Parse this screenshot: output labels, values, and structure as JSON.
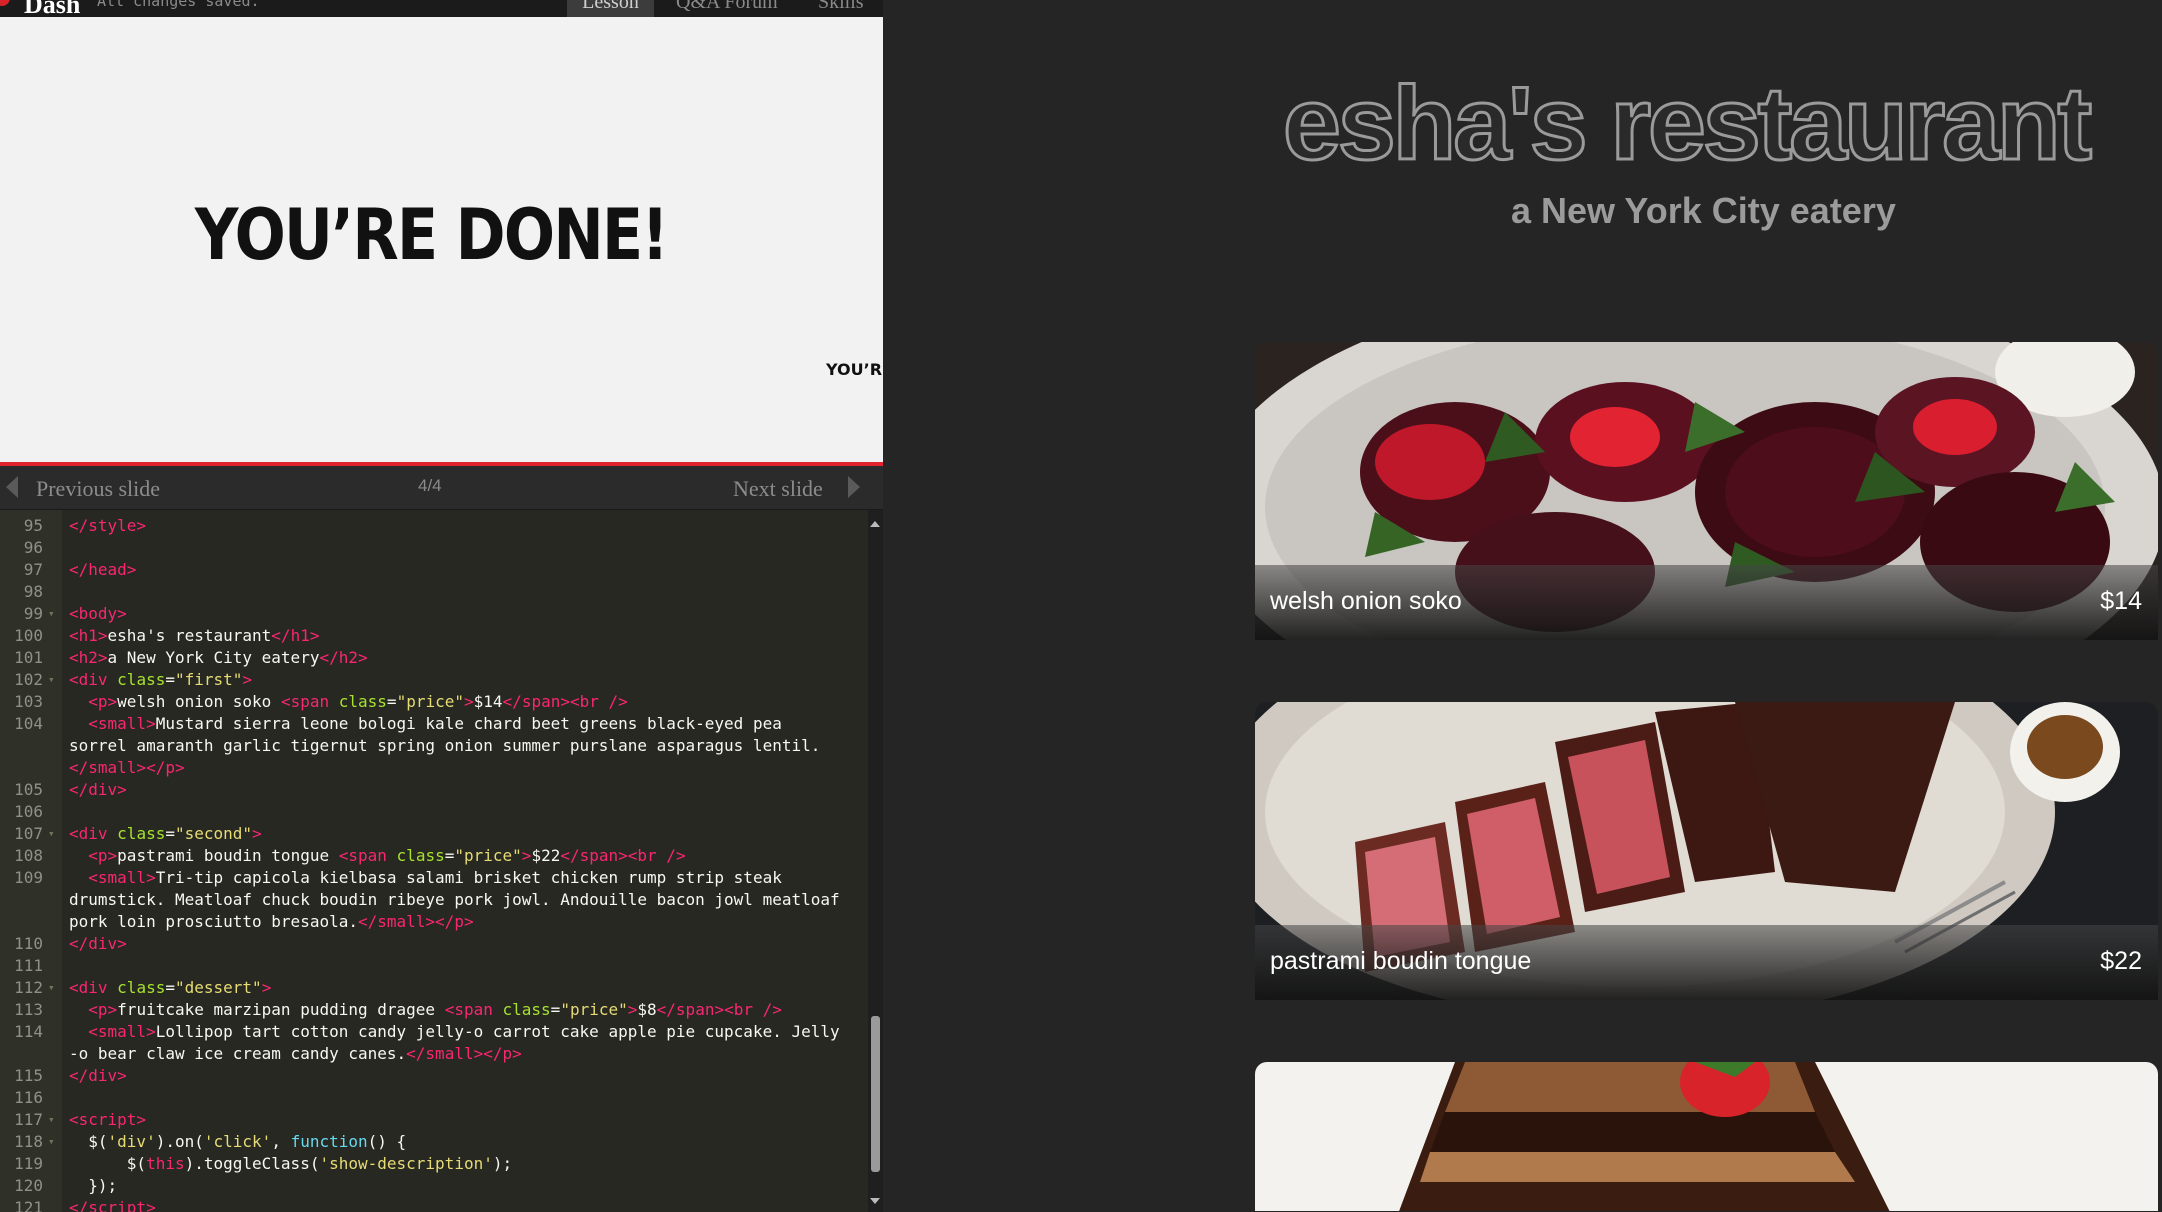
{
  "topbar": {
    "brand": "Dash",
    "save_status": "All changes saved.",
    "tabs": [
      "Lesson",
      "Q&A Forum",
      "Skills"
    ]
  },
  "slide": {
    "title": "YOU’RE DONE!",
    "peek_text": "YOU’RE",
    "accent_color": "#e0232c"
  },
  "slide_nav": {
    "previous_label": "Previous slide",
    "counter": "4/4",
    "next_label": "Next slide"
  },
  "editor": {
    "lines": [
      {
        "n": "95",
        "fold": "",
        "html": "<span class=\"t\">&lt;/style&gt;</span>"
      },
      {
        "n": "96",
        "fold": "",
        "html": ""
      },
      {
        "n": "97",
        "fold": "",
        "html": "<span class=\"t\">&lt;/head&gt;</span>"
      },
      {
        "n": "98",
        "fold": "",
        "html": ""
      },
      {
        "n": "99",
        "fold": "▾",
        "html": "<span class=\"t\">&lt;body&gt;</span>"
      },
      {
        "n": "100",
        "fold": "",
        "html": "<span class=\"t\">&lt;h1&gt;</span>esha's restaurant<span class=\"t\">&lt;/h1&gt;</span>"
      },
      {
        "n": "101",
        "fold": "",
        "html": "<span class=\"t\">&lt;h2&gt;</span>a New York City eatery<span class=\"t\">&lt;/h2&gt;</span>"
      },
      {
        "n": "102",
        "fold": "▾",
        "html": "<span class=\"t\">&lt;div</span> <span class=\"a\">class</span>=<span class=\"s\">\"first\"</span><span class=\"t\">&gt;</span>"
      },
      {
        "n": "103",
        "fold": "",
        "html": "  <span class=\"t\">&lt;p&gt;</span>welsh onion soko <span class=\"t\">&lt;span</span> <span class=\"a\">class</span>=<span class=\"s\">\"price\"</span><span class=\"t\">&gt;</span>$14<span class=\"t\">&lt;/span&gt;&lt;br /&gt;</span>"
      },
      {
        "n": "104",
        "fold": "",
        "html": "  <span class=\"t\">&lt;small&gt;</span>Mustard sierra leone bologi kale chard beet greens black-eyed pea"
      },
      {
        "n": "",
        "fold": "",
        "html": "sorrel amaranth garlic tigernut spring onion summer purslane asparagus lentil."
      },
      {
        "n": "",
        "fold": "",
        "html": "<span class=\"t\">&lt;/small&gt;&lt;/p&gt;</span>"
      },
      {
        "n": "105",
        "fold": "",
        "html": "<span class=\"t\">&lt;/div&gt;</span>"
      },
      {
        "n": "106",
        "fold": "",
        "html": ""
      },
      {
        "n": "107",
        "fold": "▾",
        "html": "<span class=\"t\">&lt;div</span> <span class=\"a\">class</span>=<span class=\"s\">\"second\"</span><span class=\"t\">&gt;</span>"
      },
      {
        "n": "108",
        "fold": "",
        "html": "  <span class=\"t\">&lt;p&gt;</span>pastrami boudin tongue <span class=\"t\">&lt;span</span> <span class=\"a\">class</span>=<span class=\"s\">\"price\"</span><span class=\"t\">&gt;</span>$22<span class=\"t\">&lt;/span&gt;&lt;br /&gt;</span>"
      },
      {
        "n": "109",
        "fold": "",
        "html": "  <span class=\"t\">&lt;small&gt;</span>Tri-tip capicola kielbasa salami brisket chicken rump strip steak"
      },
      {
        "n": "",
        "fold": "",
        "html": "drumstick. Meatloaf chuck boudin ribeye pork jowl. Andouille bacon jowl meatloaf"
      },
      {
        "n": "",
        "fold": "",
        "html": "pork loin prosciutto bresaola.<span class=\"t\">&lt;/small&gt;&lt;/p&gt;</span>"
      },
      {
        "n": "110",
        "fold": "",
        "html": "<span class=\"t\">&lt;/div&gt;</span>"
      },
      {
        "n": "111",
        "fold": "",
        "html": ""
      },
      {
        "n": "112",
        "fold": "▾",
        "html": "<span class=\"t\">&lt;div</span> <span class=\"a\">class</span>=<span class=\"s\">\"dessert\"</span><span class=\"t\">&gt;</span>"
      },
      {
        "n": "113",
        "fold": "",
        "html": "  <span class=\"t\">&lt;p&gt;</span>fruitcake marzipan pudding dragee <span class=\"t\">&lt;span</span> <span class=\"a\">class</span>=<span class=\"s\">\"price\"</span><span class=\"t\">&gt;</span>$8<span class=\"t\">&lt;/span&gt;&lt;br /&gt;</span>"
      },
      {
        "n": "114",
        "fold": "",
        "html": "  <span class=\"t\">&lt;small&gt;</span>Lollipop tart cotton candy jelly-o carrot cake apple pie cupcake. Jelly"
      },
      {
        "n": "",
        "fold": "",
        "html": "-o bear claw ice cream candy canes.<span class=\"t\">&lt;/small&gt;&lt;/p&gt;</span>"
      },
      {
        "n": "115",
        "fold": "",
        "html": "<span class=\"t\">&lt;/div&gt;</span>"
      },
      {
        "n": "116",
        "fold": "",
        "html": ""
      },
      {
        "n": "117",
        "fold": "▾",
        "html": "<span class=\"t\">&lt;script&gt;</span>"
      },
      {
        "n": "118",
        "fold": "▾",
        "html": "  $(<span class=\"s\">'div'</span>).on(<span class=\"s\">'click'</span>, <span class=\"k\">function</span>() {"
      },
      {
        "n": "119",
        "fold": "",
        "html": "      $(<span class=\"t\">this</span>).toggleClass(<span class=\"s\">'show-description'</span>);"
      },
      {
        "n": "120",
        "fold": "",
        "html": "  });"
      },
      {
        "n": "121",
        "fold": "",
        "html": "<span class=\"t\">&lt;/script&gt;</span>"
      }
    ]
  },
  "site": {
    "title": "esha's restaurant",
    "subtitle": "a New York City eatery",
    "items": [
      {
        "name": "welsh onion soko",
        "price": "$14"
      },
      {
        "name": "pastrami boudin tongue",
        "price": "$22"
      },
      {
        "name": "",
        "price": ""
      }
    ]
  }
}
